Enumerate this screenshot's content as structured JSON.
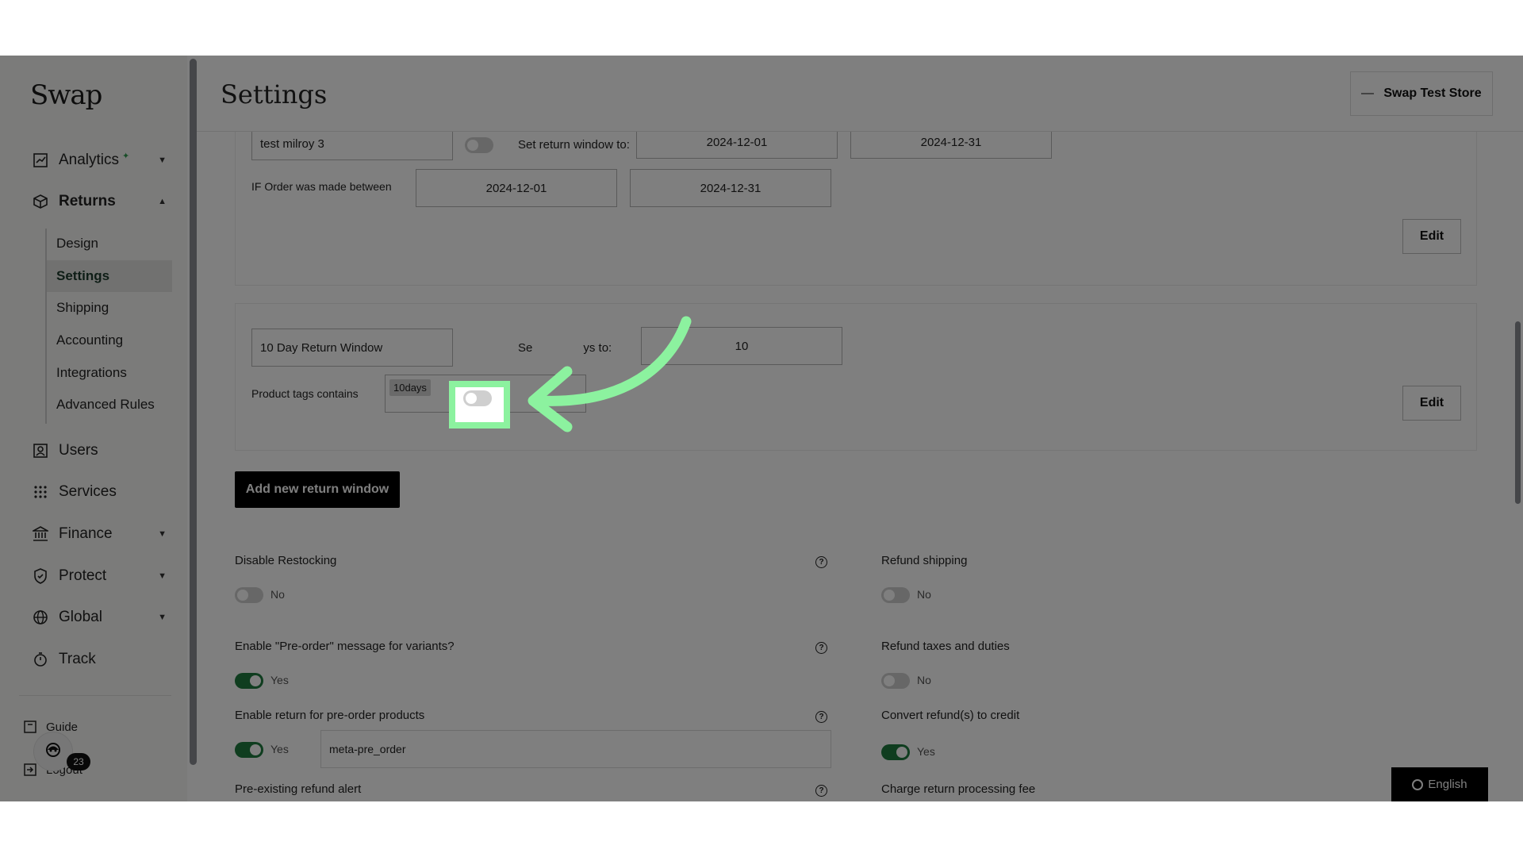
{
  "brand": {
    "logo": "Swap"
  },
  "sidebar": {
    "items": [
      {
        "label": "Analytics"
      },
      {
        "label": "Returns"
      },
      {
        "label": "Users"
      },
      {
        "label": "Services"
      },
      {
        "label": "Finance"
      },
      {
        "label": "Protect"
      },
      {
        "label": "Global"
      },
      {
        "label": "Track"
      }
    ],
    "returns_sub": [
      {
        "label": "Design"
      },
      {
        "label": "Settings"
      },
      {
        "label": "Shipping"
      },
      {
        "label": "Accounting"
      },
      {
        "label": "Integrations"
      },
      {
        "label": "Advanced Rules"
      }
    ],
    "guide": "Guide",
    "logout": "Logout",
    "notif_count": "23"
  },
  "header": {
    "title": "Settings",
    "store": "Swap Test Store"
  },
  "rule1": {
    "name": "test milroy 3",
    "set_label": "Set return window to:",
    "window_from": "2024-12-01",
    "window_to": "2024-12-31",
    "cond_label": "IF Order was made between",
    "cond_from": "2024-12-01",
    "cond_to": "2024-12-31",
    "edit": "Edit"
  },
  "rule2": {
    "name": "10 Day Return Window",
    "set_label_visible": "Se",
    "set_label_tail": "ys to:",
    "days": "10",
    "cond_label": "Product tags contains",
    "tag": "10days",
    "edit": "Edit",
    "toggle_on": false
  },
  "add_button": "Add new return window",
  "settings": {
    "disable_restocking": {
      "label": "Disable Restocking",
      "value": "No",
      "on": false
    },
    "refund_shipping": {
      "label": "Refund shipping",
      "value": "No",
      "on": false
    },
    "preorder_message": {
      "label": "Enable \"Pre-order\" message for variants?",
      "value": "Yes",
      "on": true
    },
    "refund_taxes": {
      "label": "Refund taxes and duties",
      "value": "No",
      "on": false
    },
    "preorder_returns": {
      "label": "Enable return for pre-order products",
      "value": "Yes",
      "on": true,
      "field": "meta-pre_order"
    },
    "convert_credit": {
      "label": "Convert refund(s) to credit",
      "value": "Yes",
      "on": true
    },
    "preexisting_alert": {
      "label": "Pre-existing refund alert"
    },
    "processing_fee": {
      "label": "Charge return processing fee"
    }
  },
  "language": "English",
  "colors": {
    "highlight": "#8cf29f",
    "toggle_on": "#1f7a3f",
    "primary": "#000000",
    "active_nav": "#1c3b2d"
  }
}
